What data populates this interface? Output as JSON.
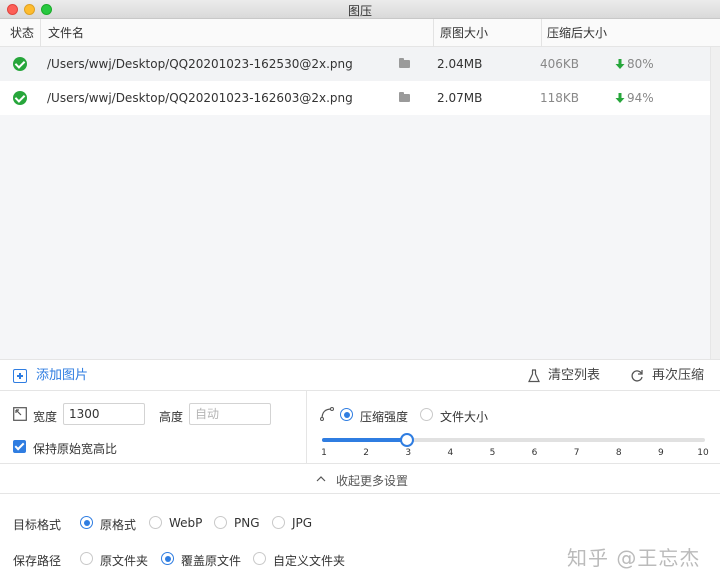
{
  "window": {
    "title": "图压"
  },
  "table": {
    "columns": {
      "status": "状态",
      "filename": "文件名",
      "original_size": "原图大小",
      "compressed_size": "压缩后大小"
    },
    "rows": [
      {
        "path": "/Users/wwj/Desktop/QQ20201023-162530@2x.png",
        "original": "2.04MB",
        "compressed": "406KB",
        "saving": "80%"
      },
      {
        "path": "/Users/wwj/Desktop/QQ20201023-162603@2x.png",
        "original": "2.07MB",
        "compressed": "118KB",
        "saving": "94%"
      }
    ]
  },
  "actions": {
    "add": "添加图片",
    "clear": "清空列表",
    "recompress": "再次压缩"
  },
  "size": {
    "width_label": "宽度",
    "width_value": "1300",
    "height_label": "高度",
    "height_placeholder": "自动",
    "keep_ratio": "保持原始宽高比",
    "keep_ratio_checked": true
  },
  "compress": {
    "mode_strength": "压缩强度",
    "mode_filesize": "文件大小",
    "selected_mode": "压缩强度",
    "slider_value": 3,
    "slider_min": 1,
    "slider_max": 10,
    "ticks": [
      "1",
      "2",
      "3",
      "4",
      "5",
      "6",
      "7",
      "8",
      "9",
      "10"
    ]
  },
  "collapse_label": "收起更多设置",
  "format": {
    "label": "目标格式",
    "options": [
      "原格式",
      "WebP",
      "PNG",
      "JPG"
    ],
    "selected": "原格式"
  },
  "save_path": {
    "label": "保存路径",
    "options": [
      "原文件夹",
      "覆盖原文件",
      "自定义文件夹"
    ],
    "selected": "覆盖原文件"
  },
  "watermark": "知乎 @王忘杰",
  "colors": {
    "accent": "#2f7de1",
    "success": "#27a63b"
  }
}
